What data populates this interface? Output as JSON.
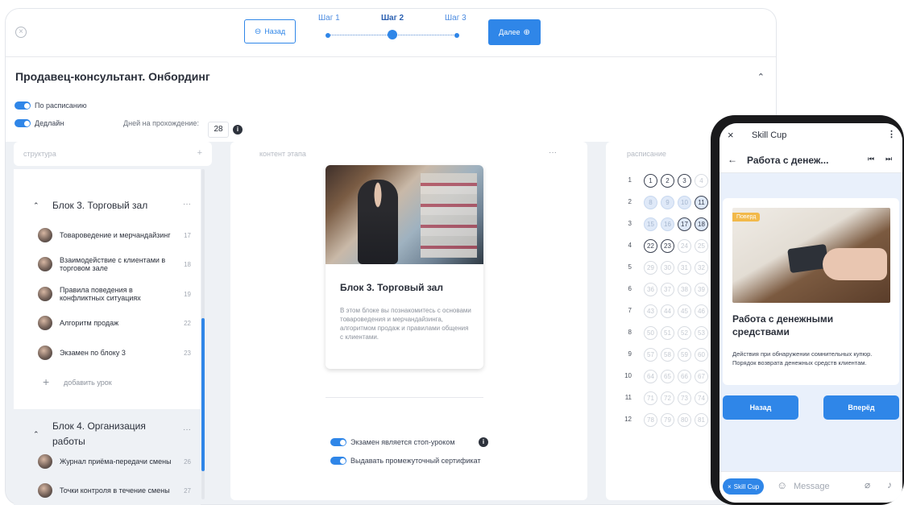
{
  "topbar": {
    "back_label": "Назад",
    "next_label": "Далее",
    "steps": [
      "Шаг 1",
      "Шаг 2",
      "Шаг 3"
    ]
  },
  "header": {
    "title": "Продавец-консультант. Онбординг",
    "toggle_schedule_label": "По расписанию",
    "toggle_deadline_label": "Дедлайн",
    "days_label": "Дней на прохождение:",
    "days_value": "28"
  },
  "structure": {
    "header": "структура",
    "add_glyph": "+",
    "block3_title": "Блок 3. Торговый зал",
    "lessons": [
      {
        "title": "Товароведение и мерчандайзинг",
        "num": "17"
      },
      {
        "title": "Взаимодействие с клиентами в торговом зале",
        "num": "18"
      },
      {
        "title": "Правила поведения в конфликтных ситуациях",
        "num": "19"
      },
      {
        "title": "Алгоритм продаж",
        "num": "22"
      },
      {
        "title": "Экзамен по блоку 3",
        "num": "23"
      }
    ],
    "add_lesson_label": "добавить урок",
    "block4_title": "Блок 4. Организация работы",
    "block4_lessons": [
      {
        "title": "Журнал приёма-передачи смены",
        "num": "26"
      },
      {
        "title": "Точки контроля в течение смены",
        "num": "27"
      }
    ]
  },
  "content": {
    "header": "контент этапа",
    "card_title": "Блок 3. Торговый зал",
    "card_text": "В этом блоке вы познакомитесь с основами товароведения и мерчандайзинга, алгоритмом продаж и правилами общения с клиентами.",
    "toggle_exam_label": "Экзамен является стоп-уроком",
    "toggle_cert_label": "Выдавать промежуточный сертификат"
  },
  "schedule": {
    "header": "расписание",
    "rows": [
      {
        "n": "1",
        "cells": [
          "1",
          "2",
          "3",
          "4"
        ]
      },
      {
        "n": "2",
        "cells": [
          "8",
          "9",
          "10",
          "11"
        ]
      },
      {
        "n": "3",
        "cells": [
          "15",
          "16",
          "17",
          "18"
        ]
      },
      {
        "n": "4",
        "cells": [
          "22",
          "23",
          "24",
          "25"
        ]
      },
      {
        "n": "5",
        "cells": [
          "29",
          "30",
          "31",
          "32"
        ]
      },
      {
        "n": "6",
        "cells": [
          "36",
          "37",
          "38",
          "39"
        ]
      },
      {
        "n": "7",
        "cells": [
          "43",
          "44",
          "45",
          "46"
        ]
      },
      {
        "n": "8",
        "cells": [
          "50",
          "51",
          "52",
          "53"
        ]
      },
      {
        "n": "9",
        "cells": [
          "57",
          "58",
          "59",
          "60"
        ]
      },
      {
        "n": "10",
        "cells": [
          "64",
          "65",
          "66",
          "67"
        ]
      },
      {
        "n": "11",
        "cells": [
          "71",
          "72",
          "73",
          "74"
        ]
      },
      {
        "n": "12",
        "cells": [
          "78",
          "79",
          "80",
          "81"
        ]
      }
    ]
  },
  "phone": {
    "app_title": "Skill Cup",
    "lesson_title": "Работа с денеж...",
    "badge": "Поверд",
    "card_title": "Работа с денежными средствами",
    "card_text": "Действия при обнаружении сомнительных купюр. Порядок возврата денежных средств клиентам.",
    "btn_back": "Назад",
    "btn_forward": "Вперёд",
    "chip_label": "Skill Cup",
    "message_placeholder": "Message"
  },
  "colors": {
    "accent": "#2f86e8",
    "panel_bg": "#eef1f5"
  }
}
